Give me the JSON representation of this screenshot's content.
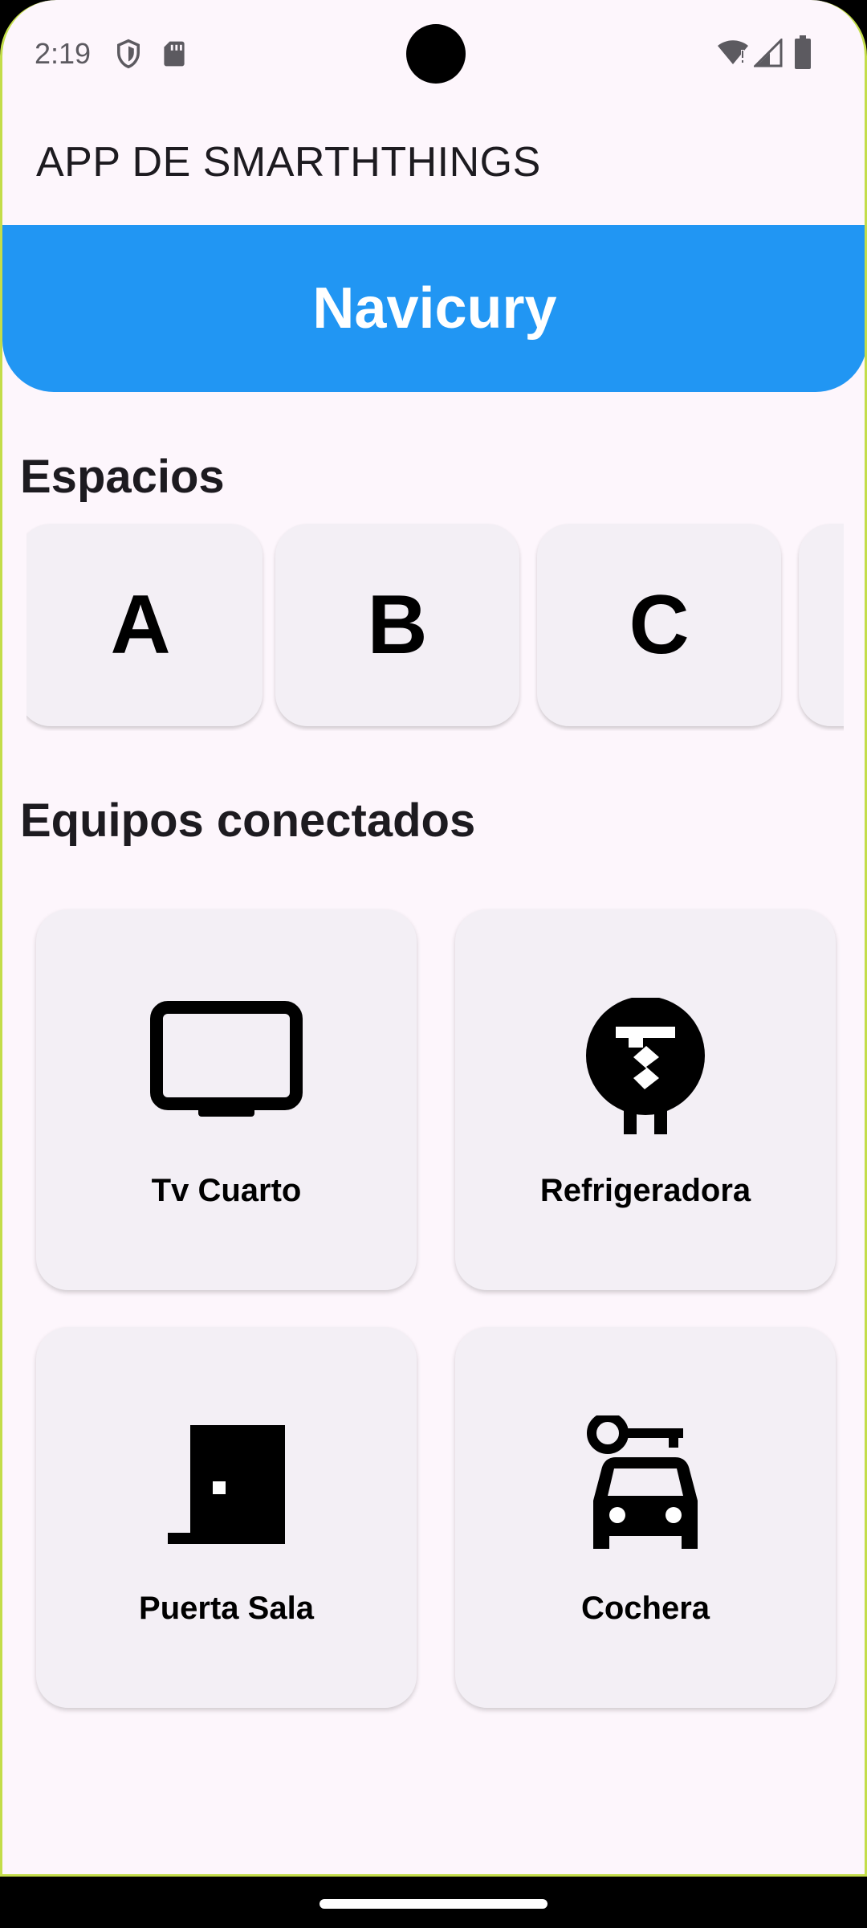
{
  "status_bar": {
    "time": "2:19"
  },
  "app_bar": {
    "title": "APP DE SMARTHTHINGS"
  },
  "banner": {
    "title": "Navicury"
  },
  "spaces": {
    "heading": "Espacios",
    "items": [
      {
        "label": "A"
      },
      {
        "label": "B"
      },
      {
        "label": "C"
      }
    ]
  },
  "devices": {
    "heading": "Equipos conectados",
    "items": [
      {
        "label": "Tv Cuarto",
        "icon": "tv-icon"
      },
      {
        "label": "Refrigeradora",
        "icon": "thermostat-icon"
      },
      {
        "label": "Puerta Sala",
        "icon": "door-icon"
      },
      {
        "label": "Cochera",
        "icon": "car-key-icon"
      }
    ]
  },
  "colors": {
    "banner": "#2196f3",
    "background": "#fdf6fc",
    "card": "#f3eff5"
  }
}
